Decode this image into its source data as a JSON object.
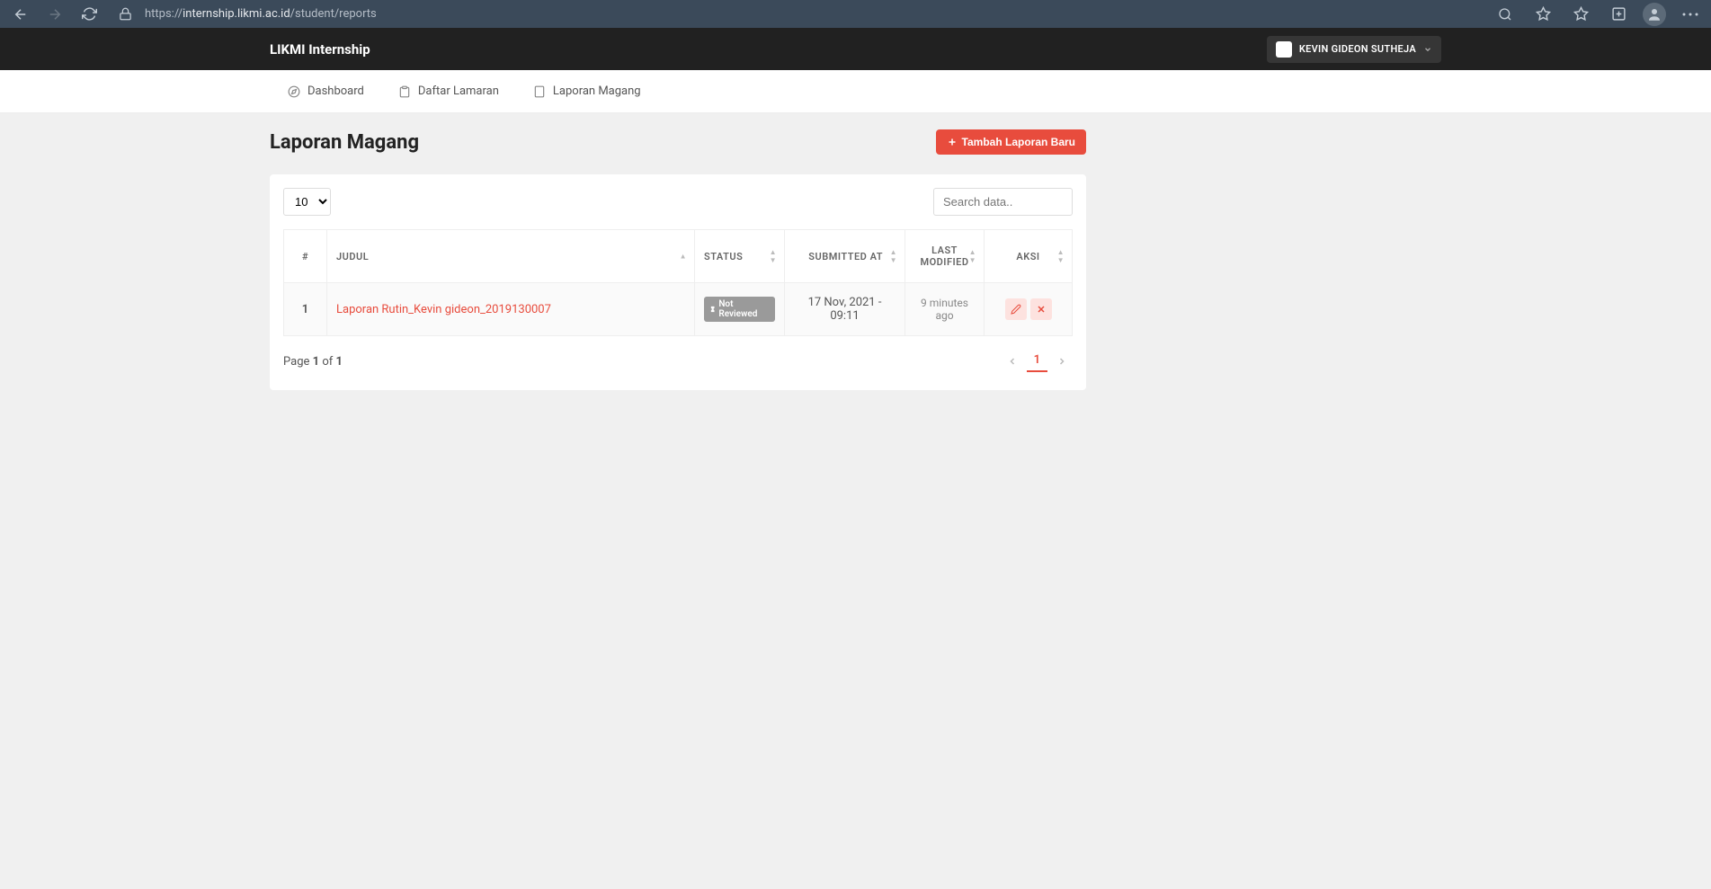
{
  "browser": {
    "url_prefix": "https://",
    "url_domain": "internship.likmi.ac.id",
    "url_path": "/student/reports"
  },
  "header": {
    "brand": "LIKMI Internship",
    "user_name": "KEVIN GIDEON SUTHEJA"
  },
  "tabs": {
    "dashboard": "Dashboard",
    "daftar": "Daftar Lamaran",
    "laporan": "Laporan Magang"
  },
  "page": {
    "title": "Laporan Magang",
    "add_button": "Tambah Laporan Baru"
  },
  "table": {
    "per_page": "10",
    "search_placeholder": "Search data..",
    "cols": {
      "num": "#",
      "judul": "JUDUL",
      "status": "STATUS",
      "submitted": "SUBMITTED AT",
      "modified": "LAST MODIFIED",
      "aksi": "AKSI"
    },
    "rows": [
      {
        "num": "1",
        "judul": "Laporan Rutin_Kevin gideon_2019130007",
        "status": "Not Reviewed",
        "submitted": "17 Nov, 2021 - 09:11",
        "modified": "9 minutes ago"
      }
    ],
    "page_info_prefix": "Page ",
    "page_current": "1",
    "page_of": " of ",
    "page_total": "1",
    "pager_current": "1"
  }
}
